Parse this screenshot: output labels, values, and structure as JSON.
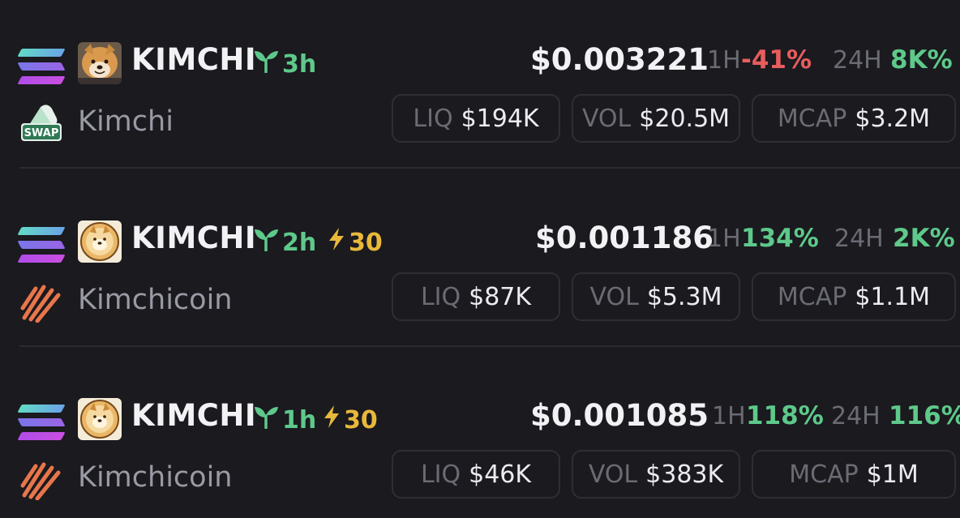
{
  "rows": [
    {
      "ticker": "KIMCHI",
      "age": "3h",
      "boost": null,
      "name": "Kimchi",
      "dex_icon": "swap-icon",
      "price": "$0.003221",
      "h1_label": "1H",
      "h1_change": "-41%",
      "h1_status": "negative",
      "h24_label": "24H",
      "h24_change": "8K%",
      "liq_label": "LIQ",
      "liq": "$194K",
      "vol_label": "VOL",
      "vol": "$20.5M",
      "mcap_label": "MCAP",
      "mcap": "$3.2M"
    },
    {
      "ticker": "KIMCHI",
      "age": "2h",
      "boost": "30",
      "name": "Kimchicoin",
      "dex_icon": "claw-dex-icon",
      "price": "$0.001186",
      "h1_label": "1H",
      "h1_change": "134%",
      "h1_status": "positive",
      "h24_label": "24H",
      "h24_change": "2K%",
      "liq_label": "LIQ",
      "liq": "$87K",
      "vol_label": "VOL",
      "vol": "$5.3M",
      "mcap_label": "MCAP",
      "mcap": "$1.1M"
    },
    {
      "ticker": "KIMCHI",
      "age": "1h",
      "boost": "30",
      "name": "Kimchicoin",
      "dex_icon": "claw-dex-icon",
      "price": "$0.001085",
      "h1_label": "1H",
      "h1_change": "118%",
      "h1_status": "positive",
      "h24_label": "24H",
      "h24_change": "116%",
      "liq_label": "LIQ",
      "liq": "$46K",
      "vol_label": "VOL",
      "vol": "$383K",
      "mcap_label": "MCAP",
      "mcap": "$1M"
    }
  ],
  "colors": {
    "background": "#1a1a1f",
    "positive": "#5ec98a",
    "negative": "#e85d5d",
    "boost": "#e8b83a",
    "muted": "#6b6b74"
  }
}
